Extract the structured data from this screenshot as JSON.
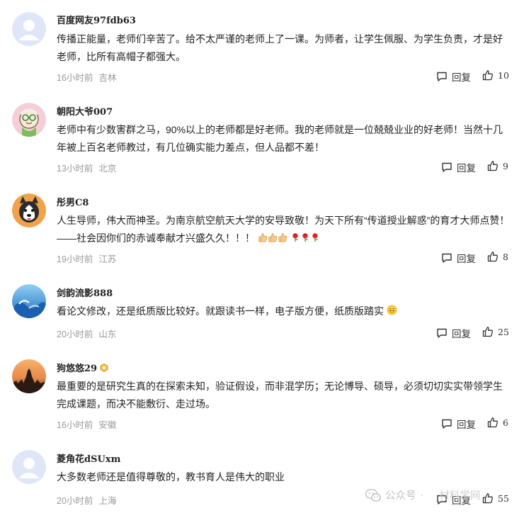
{
  "comments": [
    {
      "username": "百度网友97fdb63",
      "content": "传播正能量，老师们辛苦了。给不太严谨的老师上了一课。为师者，让学生佩服、为学生负责，才是好老师，比所有高帽子都强大。",
      "time": "16小时前",
      "location": "吉林",
      "reply_label": "回复",
      "likes": "10",
      "avatar_icon": "default-avatar-icon"
    },
    {
      "username": "朝阳大爷007",
      "content": "老师中有少数害群之马，90%以上的老师都是好老师。我的老师就是一位兢兢业业的好老师！当然十几年被上百名老师教过，有几位确实能力差点，但人品都不差！",
      "time": "13小时前",
      "location": "北京",
      "reply_label": "回复",
      "likes": "9",
      "avatar_icon": "cartoon-grandpa-avatar"
    },
    {
      "username": "彤男C8",
      "content": "人生导师，伟大而神圣。为南京航空航天大学的安导致敬！为天下所有“传道授业解惑”的育才大师点赞！——社会因你们的赤诚奉献才兴盛久久！！！",
      "content_emojis": [
        "thumbs-up-emoji",
        "thumbs-up-emoji",
        "thumbs-up-emoji",
        "rose-emoji",
        "rose-emoji",
        "rose-emoji"
      ],
      "time": "19小时前",
      "location": "江苏",
      "reply_label": "回复",
      "likes": "8",
      "avatar_icon": "husky-dog-avatar"
    },
    {
      "username": "剑韵流影888",
      "content": "看论文修改，还是纸质版比较好。就跟读书一样，电子版方便，纸质版踏实",
      "content_emojis": [
        "grinning-face-emoji"
      ],
      "time": "20小时前",
      "location": "山东",
      "reply_label": "回复",
      "likes": "25",
      "avatar_icon": "ocean-wave-avatar"
    },
    {
      "username": "狗悠悠29",
      "badge_icon": "level-badge-icon",
      "content": "最重要的是研究生真的在探索未知，验证假设，而非混学历；无论博导、硕导，必须切切实实带领学生完成课题，而决不能敷衍、走过场。",
      "time": "16小时前",
      "location": "安徽",
      "reply_label": "回复",
      "likes": "6",
      "avatar_icon": "sunset-city-avatar"
    },
    {
      "username": "菱角花dSUxm",
      "content": "大多数老师还是值得尊敬的，教书育人是伟大的职业",
      "time": "20小时前",
      "location": "上海",
      "reply_label": "回复",
      "likes": "55",
      "avatar_icon": "default-avatar-icon"
    }
  ],
  "watermark": {
    "platform": "公众号",
    "separator": "·",
    "brand": "材料学网"
  },
  "colors": {
    "text": "#222222",
    "meta": "#999999",
    "default_avatar_bg": "#dfe6f7",
    "default_avatar_fg": "#ffffff"
  }
}
